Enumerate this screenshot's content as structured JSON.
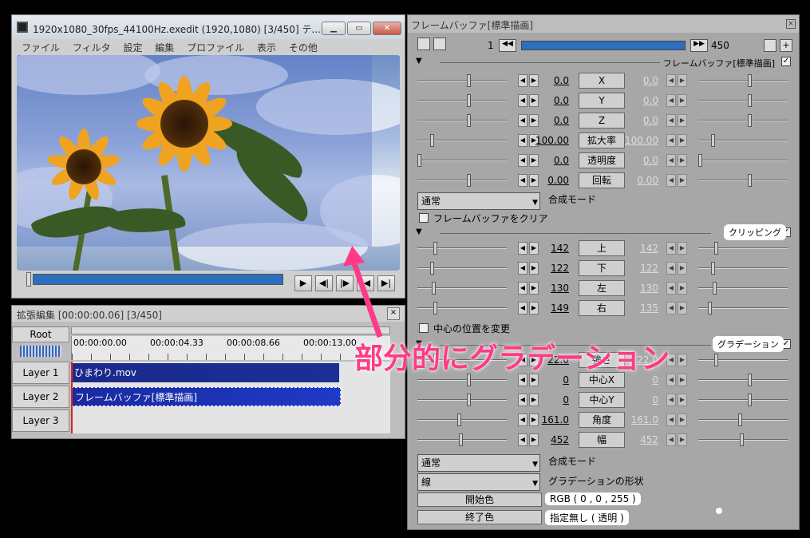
{
  "preview": {
    "title": "1920x1080_30fps_44100Hz.exedit (1920,1080)  [3/450]  テ...",
    "menu": [
      "ファイル",
      "フィルタ",
      "設定",
      "編集",
      "プロファイル",
      "表示",
      "その他"
    ],
    "buttons": {
      "minimize": "▁",
      "maximize": "▭",
      "close": "✕"
    },
    "controls": [
      "▶",
      "◀|",
      "|▶",
      "|◀",
      "▶|"
    ]
  },
  "timeline": {
    "title": "拡張編集 [00:00:00.06] [3/450]",
    "root": "Root",
    "times": [
      "00:00:00.00",
      "00:00:04.33",
      "00:00:08.66",
      "00:00:13.00"
    ],
    "layers": [
      "Layer 1",
      "Layer 2",
      "Layer 3"
    ],
    "clips": {
      "clip1": "ひまわり.mov",
      "clip2": "フレームバッファ[標準描画]"
    }
  },
  "panel": {
    "title": "フレームバッファ[標準描画]",
    "frame": "1",
    "frame_end": "450",
    "section1": "フレームバッファ[標準描画]",
    "props1": [
      {
        "v": "0.0",
        "name": "X",
        "v2": "0.0"
      },
      {
        "v": "0.0",
        "name": "Y",
        "v2": "0.0"
      },
      {
        "v": "0.0",
        "name": "Z",
        "v2": "0.0"
      },
      {
        "v": "100.00",
        "name": "拡大率",
        "v2": "100.00"
      },
      {
        "v": "0.0",
        "name": "透明度",
        "v2": "0.0"
      },
      {
        "v": "0.00",
        "name": "回転",
        "v2": "0.00"
      }
    ],
    "blend1": "通常",
    "blend_label": "合成モード",
    "clear_label": "フレームバッファをクリア",
    "section2": "クリッピング",
    "props2": [
      {
        "v": "142",
        "name": "上",
        "v2": "142"
      },
      {
        "v": "122",
        "name": "下",
        "v2": "122"
      },
      {
        "v": "130",
        "name": "左",
        "v2": "130"
      },
      {
        "v": "149",
        "name": "右",
        "v2": "135"
      }
    ],
    "center_label": "中心の位置を変更",
    "section3": "グラデーション",
    "props3": [
      {
        "v": "22.0",
        "name": "強さ",
        "v2": "22.0"
      },
      {
        "v": "0",
        "name": "中心X",
        "v2": "0"
      },
      {
        "v": "0",
        "name": "中心Y",
        "v2": "0"
      },
      {
        "v": "161.0",
        "name": "角度",
        "v2": "161.0"
      },
      {
        "v": "452",
        "name": "幅",
        "v2": "452"
      }
    ],
    "blend2": "通常",
    "shape": "線",
    "shape_label": "グラデーションの形状",
    "start_color_btn": "開始色",
    "start_color": "RGB ( 0 , 0 , 255 )",
    "end_color_btn": "終了色",
    "end_color": "指定無し ( 透明 )"
  },
  "annotation": "部分的にグラデーション"
}
